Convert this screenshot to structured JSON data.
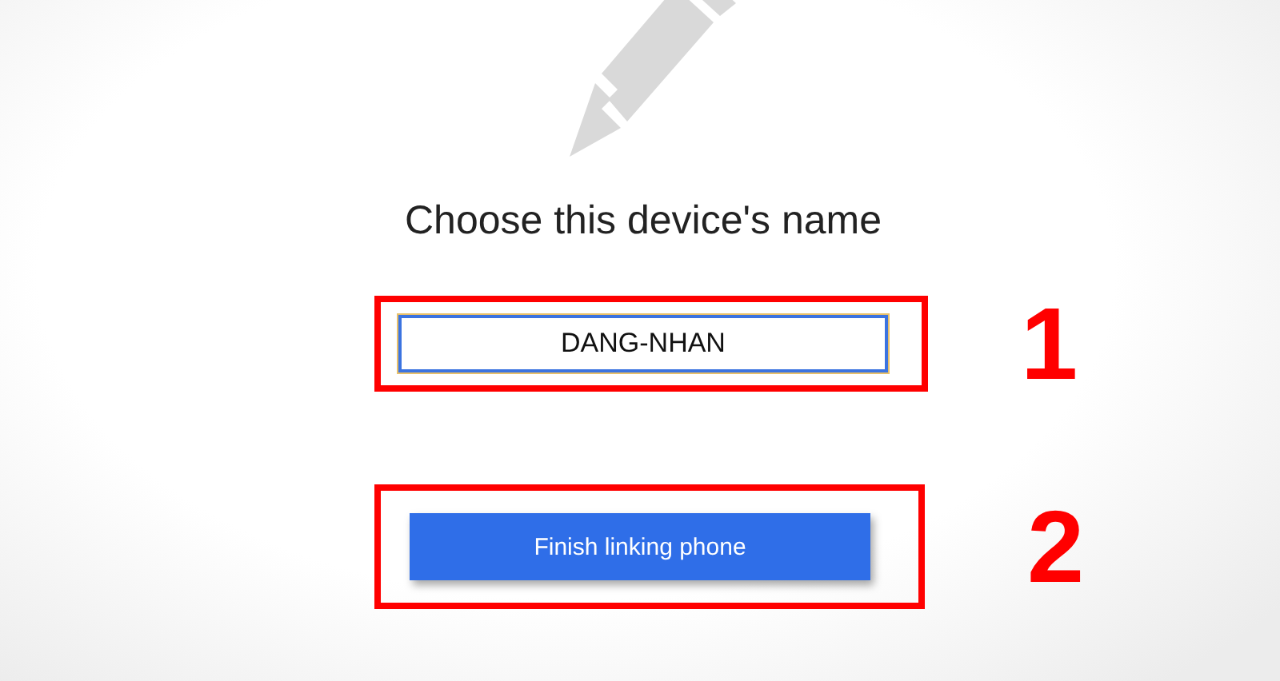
{
  "title": "Choose this device's name",
  "device_name": {
    "value": "DANG-NHAN"
  },
  "finish_button": {
    "label": "Finish linking phone"
  },
  "annotations": [
    {
      "label": "1"
    },
    {
      "label": "2"
    }
  ]
}
